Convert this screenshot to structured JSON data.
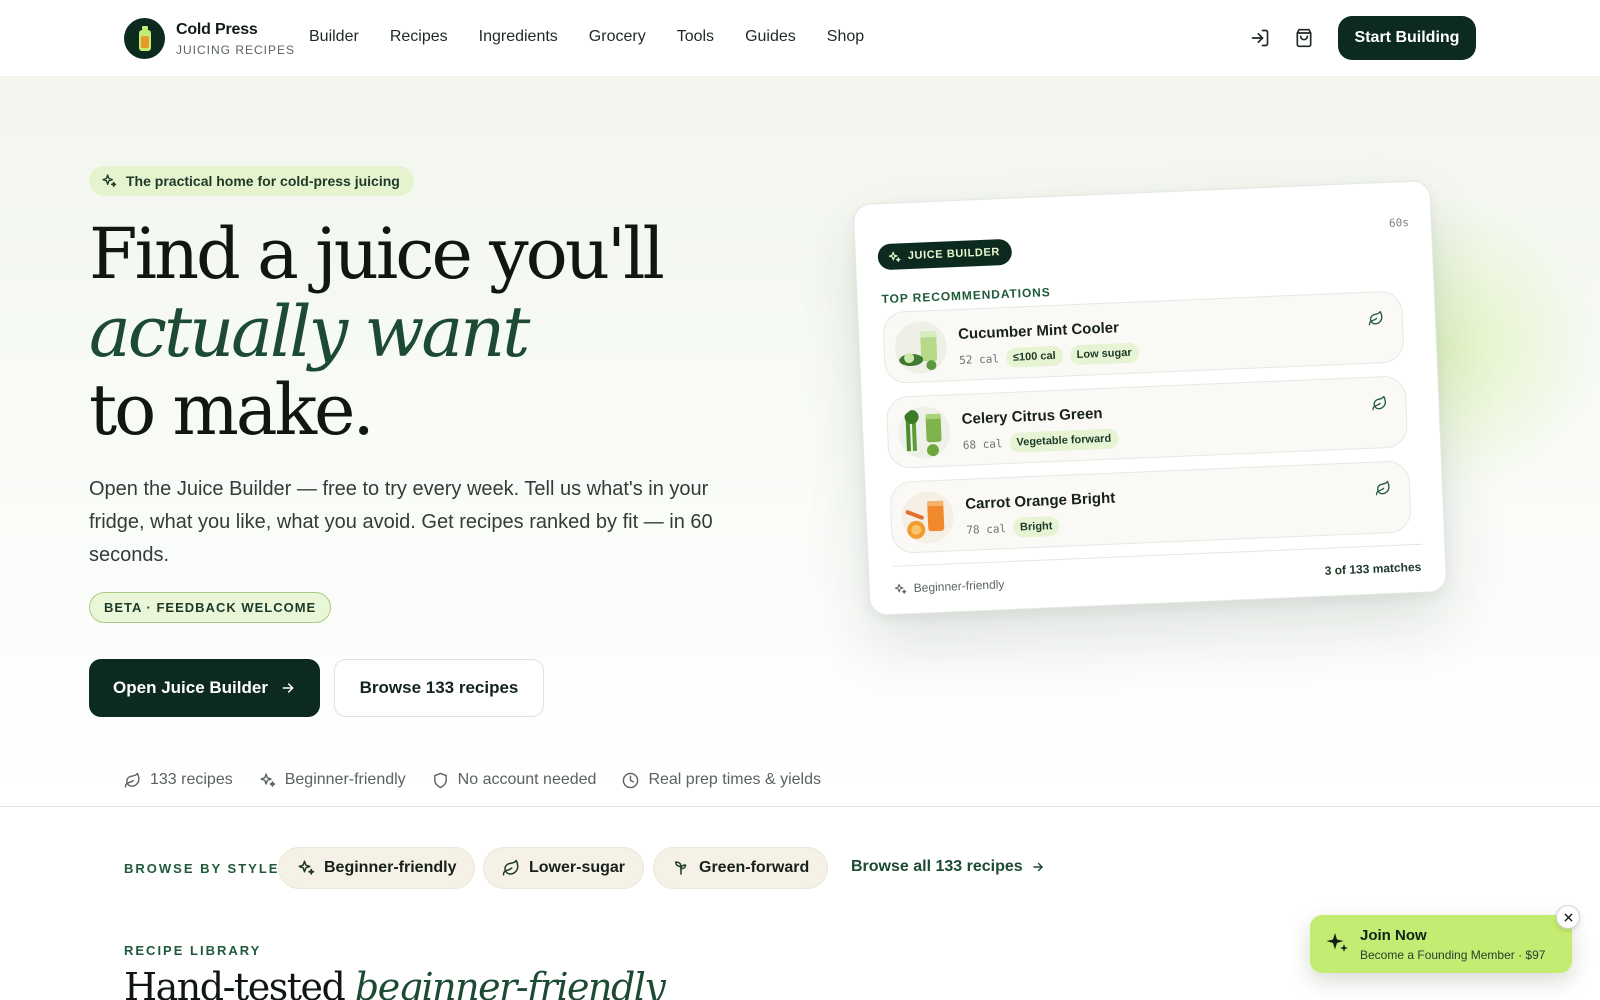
{
  "header": {
    "brand_name": "Cold Press",
    "brand_sub": "JUICING RECIPES",
    "nav": [
      "Builder",
      "Recipes",
      "Ingredients",
      "Grocery",
      "Tools",
      "Guides",
      "Shop"
    ],
    "cta": "Start Building"
  },
  "hero": {
    "eyebrow": "The practical home for cold-press juicing",
    "headline_1": "Find a juice you'll",
    "headline_em": "actually want",
    "headline_3": "to make.",
    "description": "Open the Juice Builder — free to try every week. Tell us what's in your fridge, what you like, what you avoid. Get recipes ranked by fit — in 60 seconds.",
    "beta": "BETA · FEEDBACK WELCOME",
    "primary_cta": "Open Juice Builder",
    "secondary_cta": "Browse 133 recipes"
  },
  "builder_card": {
    "pill": "JUICE BUILDER",
    "timer": "60s",
    "section_label": "TOP RECOMMENDATIONS",
    "recommendations": [
      {
        "name": "Cucumber Mint Cooler",
        "cal": "52 cal",
        "tags": [
          "≤100 cal",
          "Low sugar"
        ]
      },
      {
        "name": "Celery Citrus Green",
        "cal": "68 cal",
        "tags": [
          "Vegetable forward"
        ]
      },
      {
        "name": "Carrot Orange Bright",
        "cal": "78 cal",
        "tags": [
          "Bright"
        ]
      }
    ],
    "footer_left": "Beginner-friendly",
    "footer_right": "3 of 133 matches"
  },
  "trust": [
    "133 recipes",
    "Beginner-friendly",
    "No account needed",
    "Real prep times & yields"
  ],
  "browse": {
    "label": "BROWSE BY STYLE",
    "chips": [
      "Beginner-friendly",
      "Lower-sugar",
      "Green-forward"
    ],
    "all_link": "Browse all 133 recipes"
  },
  "library": {
    "label": "RECIPE LIBRARY",
    "title_plain": "Hand-tested",
    "title_em": "beginner-friendly"
  },
  "join": {
    "title": "Join Now",
    "subtitle": "Become a Founding Member · $97"
  },
  "colors": {
    "brand_dark": "#0d2a1e",
    "accent_green": "#1d4a33",
    "lime": "#c5ec72",
    "tag_bg": "#e7f4d3"
  }
}
